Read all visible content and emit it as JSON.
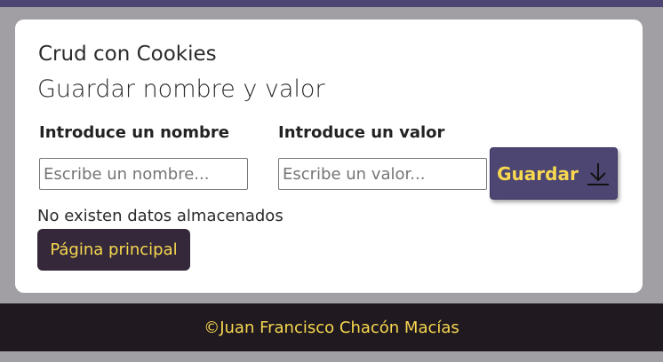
{
  "app": {
    "title": "Crud con Cookies",
    "section_title": "Guardar nombre y valor"
  },
  "form": {
    "name_label": "Introduce un nombre",
    "name_placeholder": "Escribe un nombre...",
    "value_label": "Introduce un valor",
    "value_placeholder": "Escribe un valor...",
    "save_label": "Guardar",
    "save_icon": "download-arrow-icon"
  },
  "status": {
    "empty_message": "No existen datos almacenados"
  },
  "nav": {
    "home_label": "Página principal"
  },
  "footer": {
    "text": "©Juan Francisco Chacón Macías"
  },
  "colors": {
    "accent_purple": "#4d4672",
    "accent_yellow": "#f7d84f",
    "footer_bg": "#201920",
    "home_button_bg": "#34283a",
    "page_bg": "#a19fa3"
  }
}
